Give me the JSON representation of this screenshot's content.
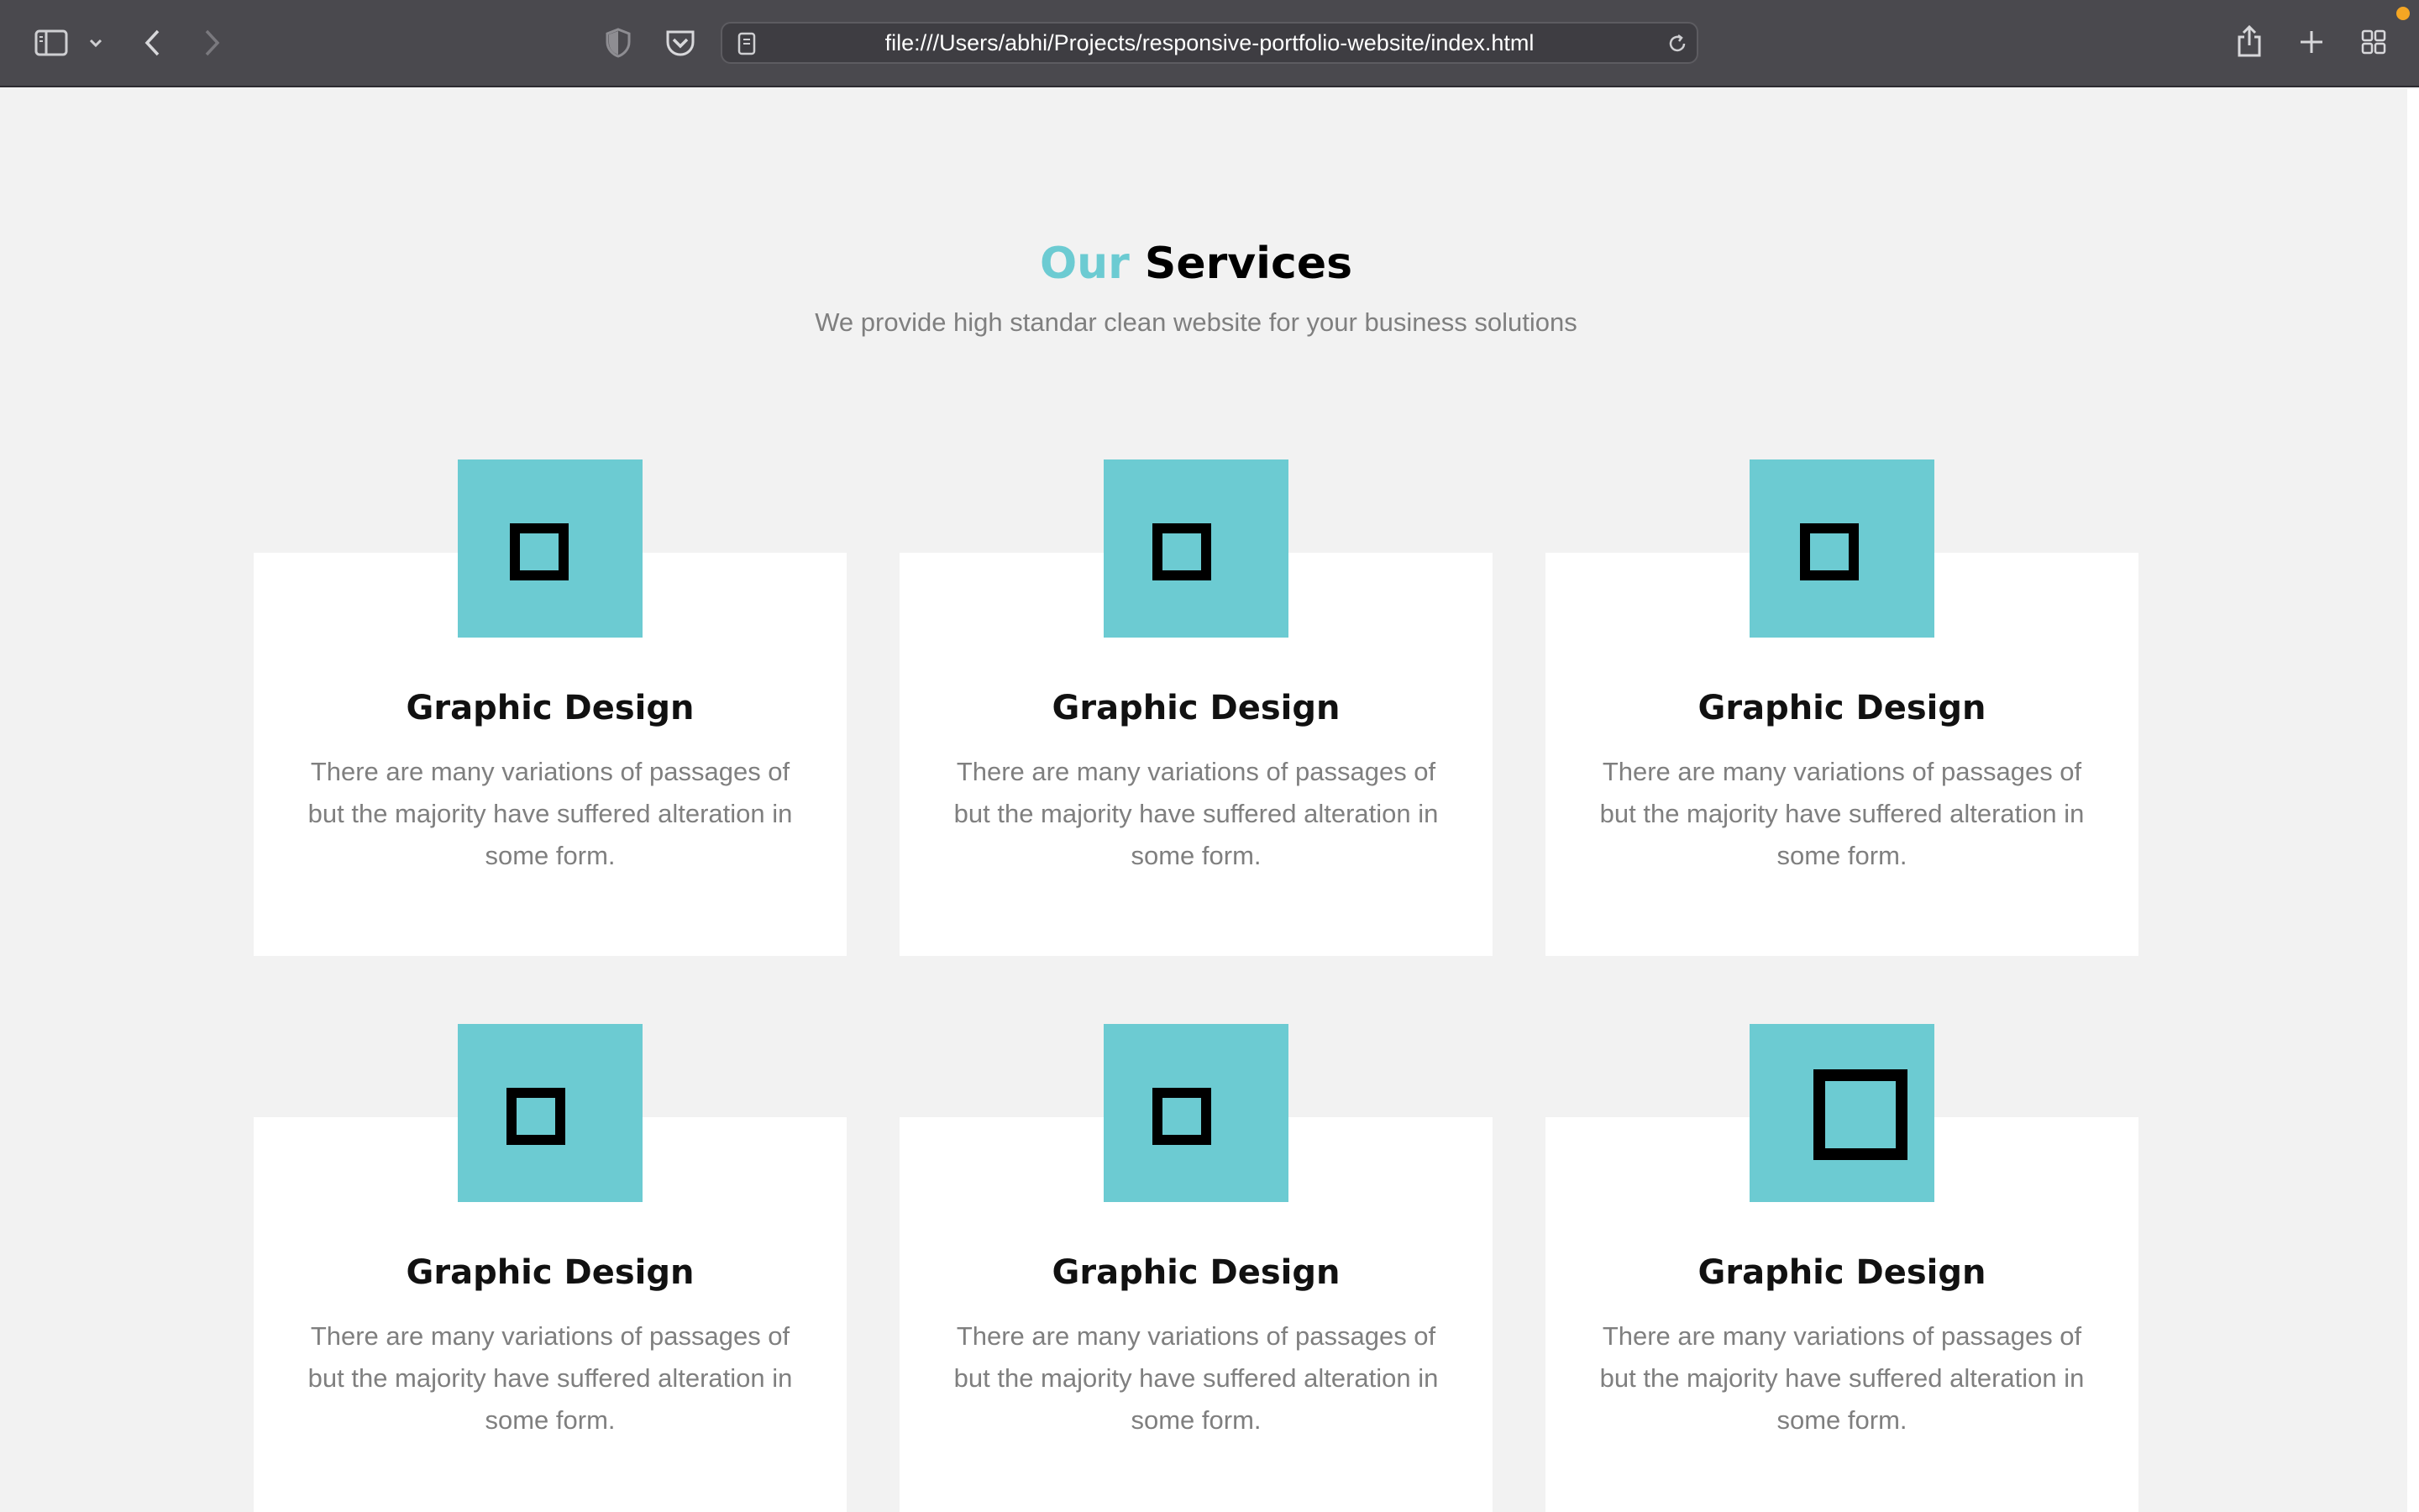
{
  "browser": {
    "url": "file:///Users/abhi/Projects/responsive-portfolio-website/index.html"
  },
  "services": {
    "title_accent": "Our",
    "title_main": "Services",
    "subtitle": "We provide high standar clean website for your business solutions",
    "accent_color": "#6ccbd2",
    "cards": [
      {
        "title": "Graphic Design",
        "text": "There are many variations of passages of but the majority have suffered alteration in some form.",
        "icon": "square-icon"
      },
      {
        "title": "Graphic Design",
        "text": "There are many variations of passages of but the majority have suffered alteration in some form.",
        "icon": "square-icon"
      },
      {
        "title": "Graphic Design",
        "text": "There are many variations of passages of but the majority have suffered alteration in some form.",
        "icon": "square-icon"
      },
      {
        "title": "Graphic Design",
        "text": "There are many variations of passages of but the majority have suffered alteration in some form.",
        "icon": "square-icon"
      },
      {
        "title": "Graphic Design",
        "text": "There are many variations of passages of but the majority have suffered alteration in some form.",
        "icon": "square-icon"
      },
      {
        "title": "Graphic Design",
        "text": "There are many variations of passages of but the majority have suffered alteration in some form.",
        "icon": "square-icon"
      }
    ]
  }
}
